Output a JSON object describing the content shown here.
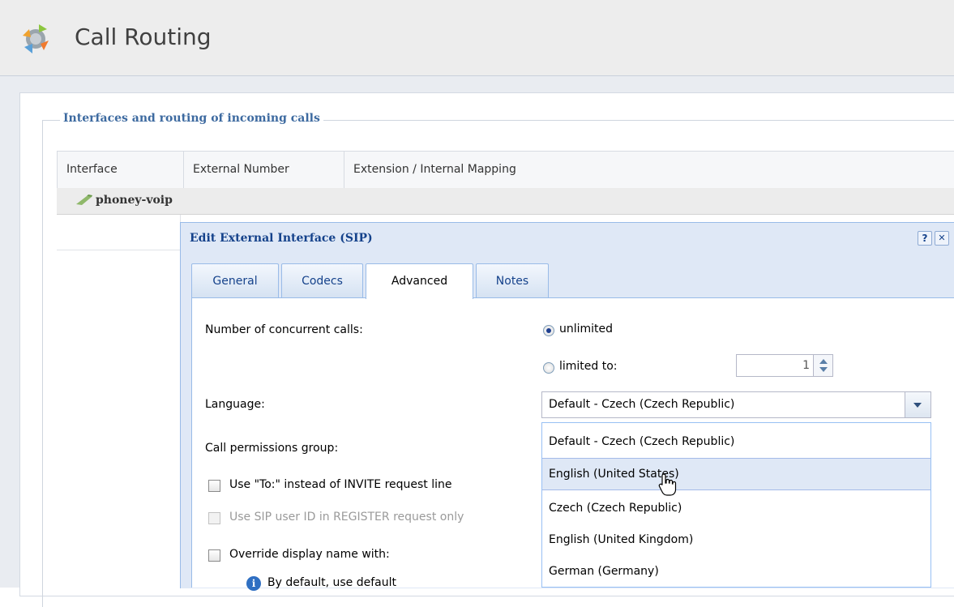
{
  "header": {
    "title": "Call Routing",
    "logo_icon": "call-routing-logo-icon"
  },
  "section": {
    "legend": "Interfaces and routing of incoming calls"
  },
  "grid": {
    "columns": [
      "Interface",
      "External Number",
      "Extension / Internal Mapping"
    ],
    "group_label": "phoney-voip"
  },
  "dialog": {
    "title": "Edit External Interface (SIP)",
    "help_label": "?",
    "close_label": "✕",
    "tabs": [
      {
        "label": "General",
        "active": false
      },
      {
        "label": "Codecs",
        "active": false
      },
      {
        "label": "Advanced",
        "active": true
      },
      {
        "label": "Notes",
        "active": false
      }
    ],
    "form": {
      "concurrent_calls_label": "Number of concurrent calls:",
      "unlimited_label": "unlimited",
      "limited_label": "limited to:",
      "limited_value": "1",
      "concurrent_calls_selected": "unlimited",
      "language_label": "Language:",
      "language_value": "Default - Czech (Czech Republic)",
      "permissions_label": "Call permissions group:",
      "use_to_label": "Use \"To:\" instead of INVITE request line",
      "use_sip_label": "Use SIP user ID in REGISTER request only",
      "override_label": "Override display name with:",
      "info_text": "By default, use default"
    },
    "language_options": [
      "Default - Czech (Czech Republic)",
      "English (United States)",
      "Czech (Czech Republic)",
      "English (United Kingdom)",
      "German (Germany)"
    ],
    "hovered_option": "English (United States)"
  },
  "colors": {
    "accent": "#15428b",
    "legend": "#3d6aa0",
    "hover": "#dfe8f6"
  }
}
